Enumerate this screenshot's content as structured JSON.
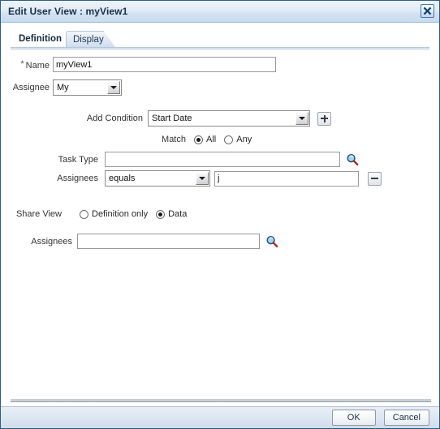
{
  "window": {
    "title": "Edit User View : myView1",
    "close_icon": "close-icon"
  },
  "tabs": [
    {
      "label": "Definition",
      "active": true
    },
    {
      "label": "Display",
      "active": false
    }
  ],
  "form": {
    "name": {
      "label": "Name",
      "required_marker": "*",
      "value": "myView1",
      "placeholder": ""
    },
    "assignee": {
      "label": "Assignee",
      "value": "My"
    },
    "add_condition": {
      "label": "Add Condition",
      "value": "Start Date",
      "add_button_icon": "plus-icon"
    },
    "match": {
      "label": "Match",
      "options": [
        {
          "label": "All",
          "selected": true
        },
        {
          "label": "Any",
          "selected": false
        }
      ]
    },
    "conditions": [
      {
        "label": "Task Type",
        "kind": "text-with-search",
        "value": "",
        "placeholder": "",
        "search_icon": "search-icon"
      },
      {
        "label": "Assignees",
        "kind": "operator-text-with-remove",
        "operator": "equals",
        "value": "j",
        "placeholder": "",
        "remove_button_icon": "minus-icon"
      }
    ],
    "share_view": {
      "label": "Share View",
      "options": [
        {
          "label": "Definition only",
          "selected": false
        },
        {
          "label": "Data",
          "selected": true
        }
      ]
    },
    "share_assignees": {
      "label": "Assignees",
      "value": "",
      "placeholder": "",
      "search_icon": "search-icon"
    }
  },
  "footer": {
    "ok_label": "OK",
    "cancel_label": "Cancel"
  },
  "colors": {
    "window_border": "#2b5d85",
    "titlebar_text": "#16304a",
    "accent_blue": "#3c78ab",
    "search_lens": "#8fd0ef",
    "search_handle": "#b02020"
  }
}
